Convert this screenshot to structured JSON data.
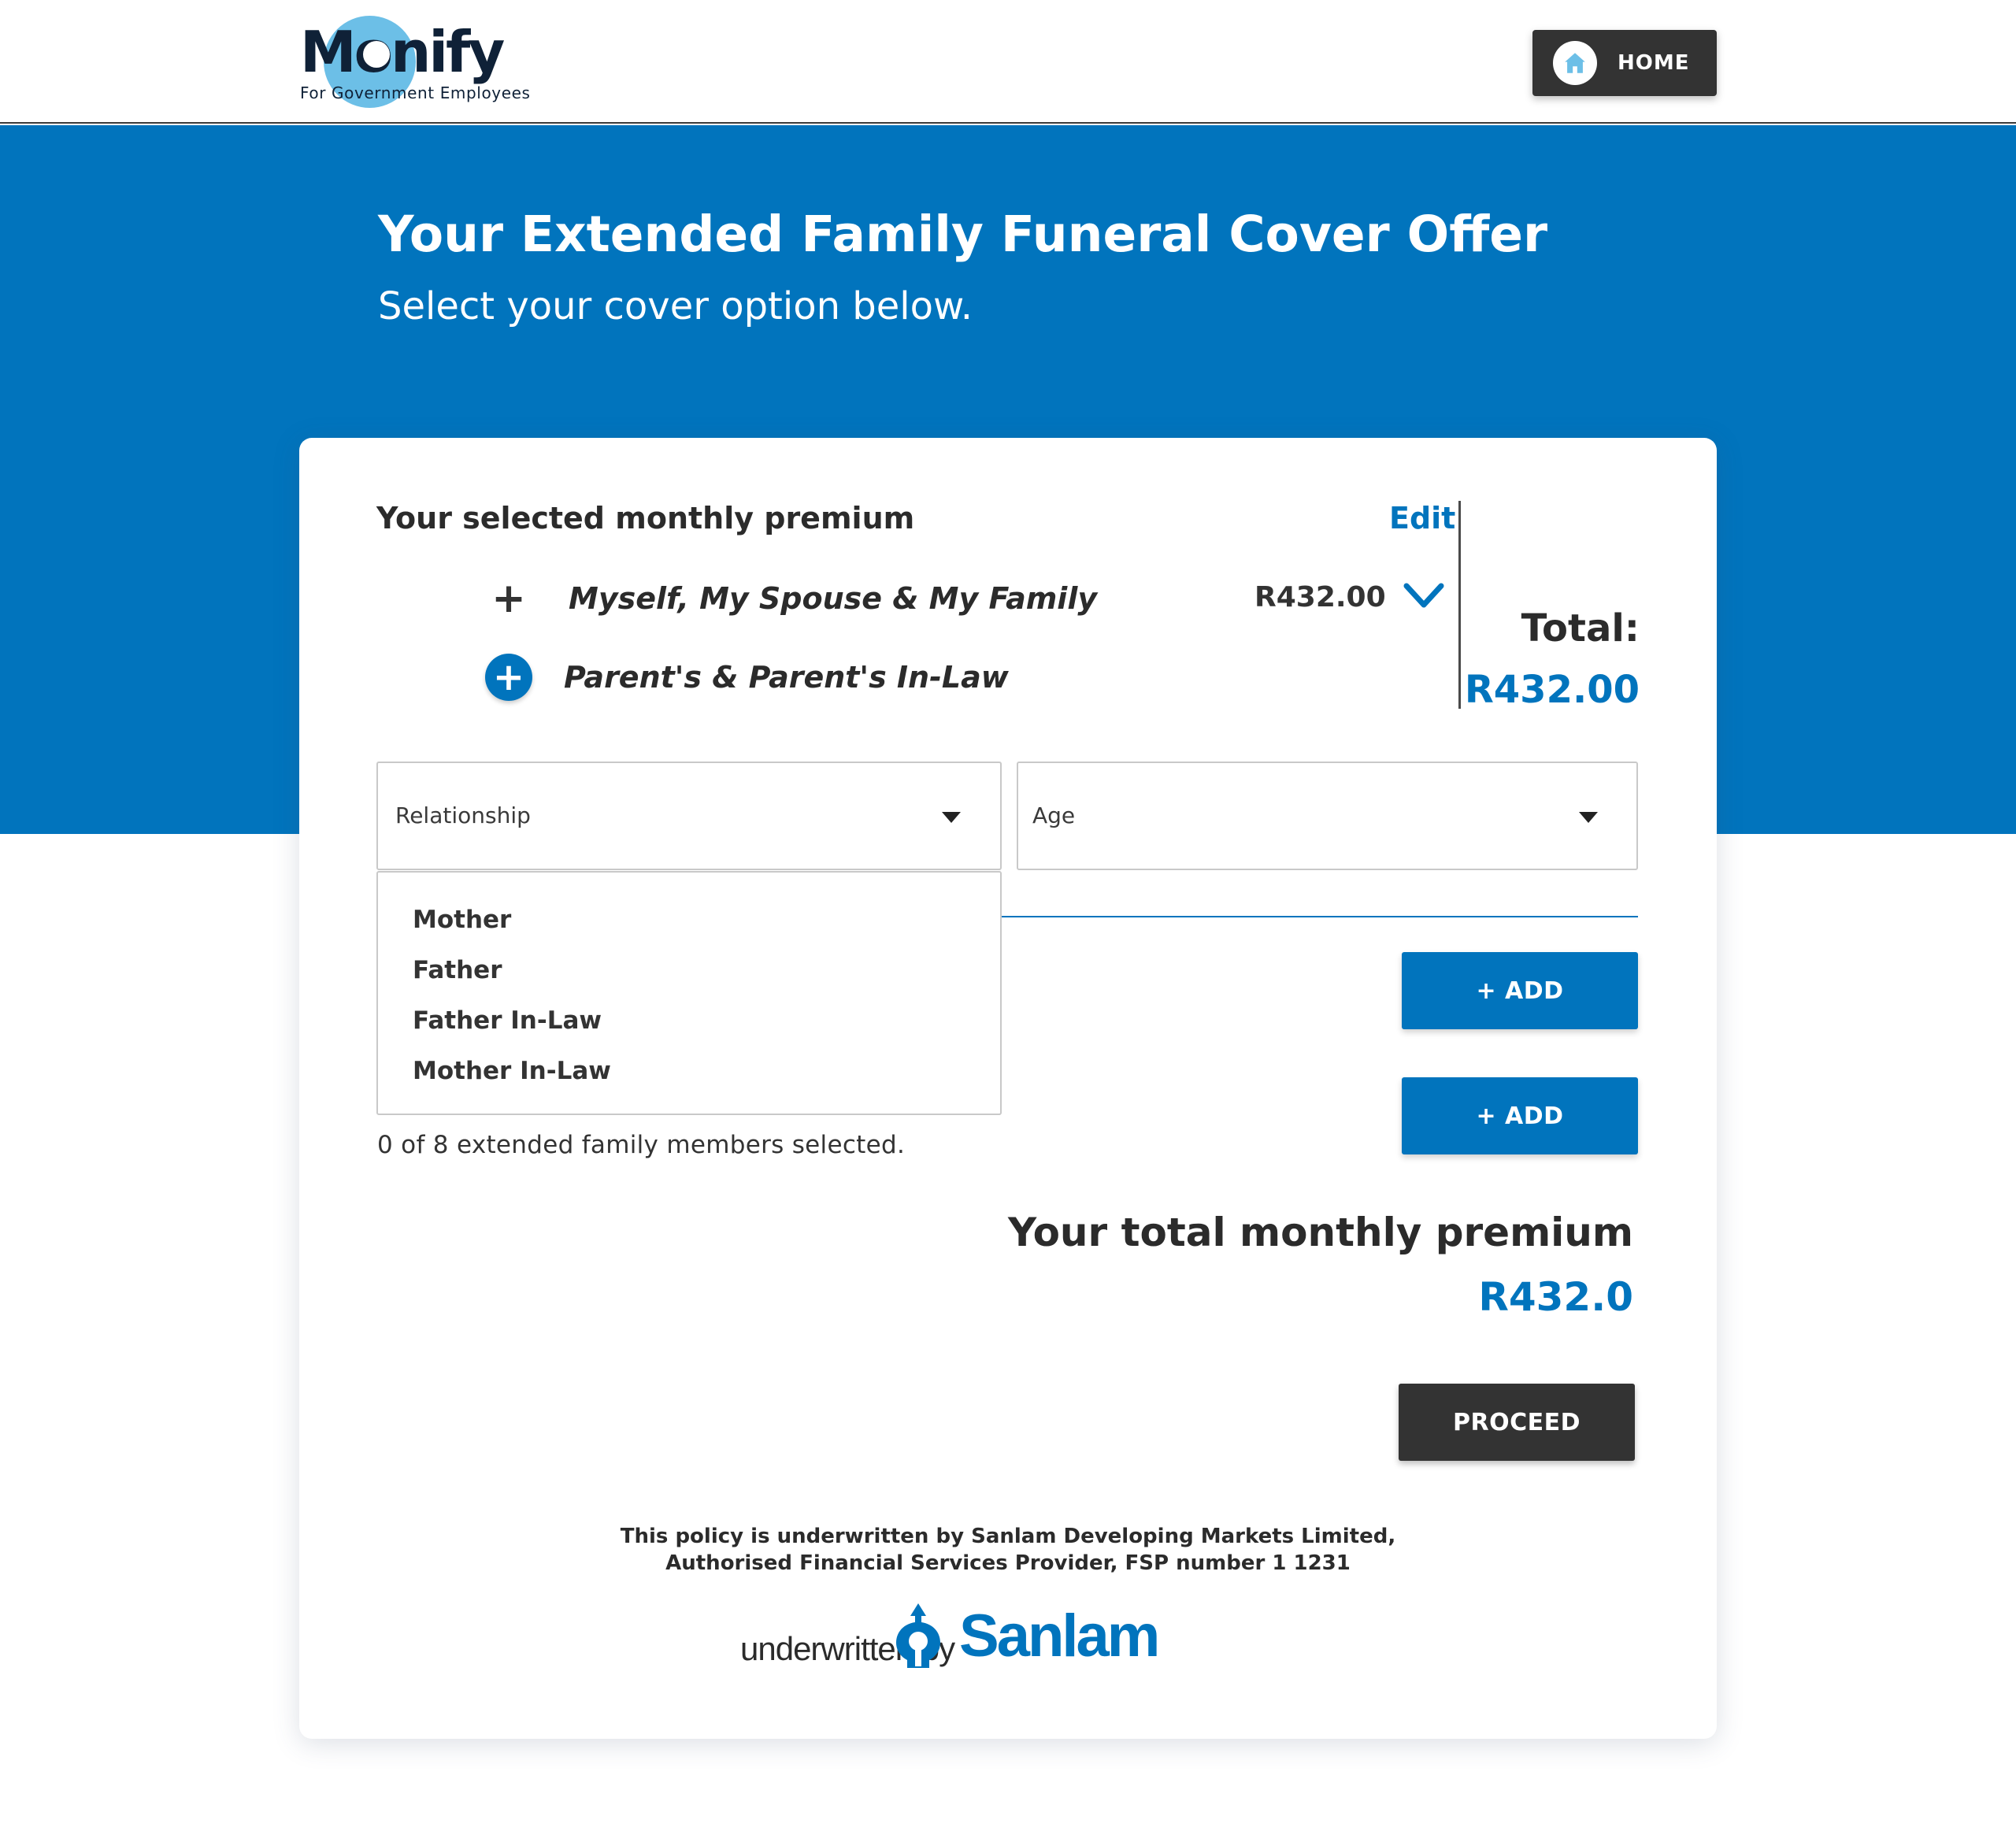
{
  "header": {
    "logo_word": "Monify",
    "logo_subtitle": "For Government Employees",
    "home_label": "HOME"
  },
  "hero": {
    "title": "Your Extended Family Funeral Cover Offer",
    "subtitle": "Select your cover option below."
  },
  "premium": {
    "heading": "Your selected monthly premium",
    "edit_label": "Edit",
    "options": [
      {
        "label": "Myself, My Spouse & My Family",
        "price": "R432.00",
        "icon": "plus-icon"
      },
      {
        "label": "Parent's & Parent's In-Law",
        "icon": "plus-circle-icon"
      }
    ],
    "total_label": "Total:",
    "total_value": "R432.00"
  },
  "form": {
    "relationship_placeholder": "Relationship",
    "age_placeholder": "Age",
    "relationship_options": [
      "Mother",
      "Father",
      "Father In-Law",
      "Mother In-Law"
    ],
    "add_label": "+ ADD",
    "selected_count_text": "0 of 8 extended family members selected."
  },
  "summary": {
    "heading": "Your total monthly premium",
    "value": "R432.0",
    "proceed_label": "PROCEED"
  },
  "footer": {
    "disclaimer_line1": "This policy is underwritten by Sanlam Developing Markets Limited,",
    "disclaimer_line2": "Authorised Financial Services Provider, FSP number 1 1231",
    "underwritten_text": "underwritten by",
    "brand": "Sanlam"
  },
  "colors": {
    "primary_blue": "#0174bd",
    "dark_button": "#333333",
    "logo_circle": "#6cbfe7"
  }
}
